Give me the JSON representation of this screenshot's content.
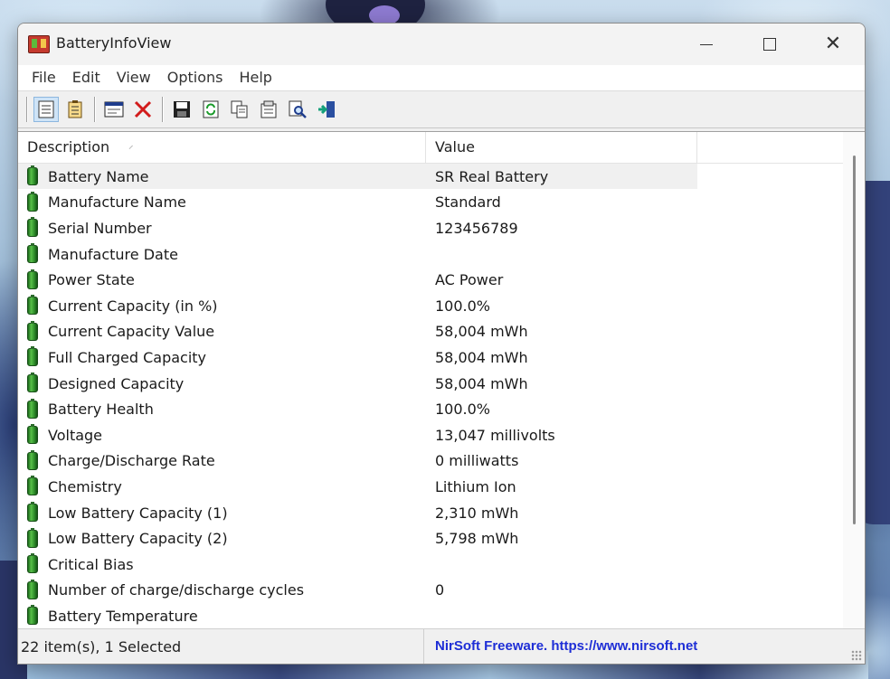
{
  "window": {
    "title": "BatteryInfoView",
    "minimize_label": "Minimize",
    "maximize_label": "Maximize",
    "close_label": "Close"
  },
  "menu": [
    "File",
    "Edit",
    "View",
    "Options",
    "Help"
  ],
  "toolbar": {
    "buttons": [
      {
        "icon": "battery-info-mode-icon",
        "active": true
      },
      {
        "icon": "battery-log-mode-icon",
        "active": false
      },
      {
        "icon": "html-report-icon",
        "active": false
      },
      {
        "icon": "delete-icon",
        "active": false
      },
      {
        "icon": "save-icon",
        "active": false
      },
      {
        "icon": "refresh-icon",
        "active": false
      },
      {
        "icon": "copy-icon",
        "active": false
      },
      {
        "icon": "properties-icon",
        "active": false
      },
      {
        "icon": "find-icon",
        "active": false
      },
      {
        "icon": "exit-icon",
        "active": false
      }
    ]
  },
  "list": {
    "columns": {
      "description": "Description",
      "value": "Value"
    },
    "rows": [
      {
        "description": "Battery Name",
        "value": "SR Real Battery",
        "selected": true
      },
      {
        "description": "Manufacture Name",
        "value": "Standard"
      },
      {
        "description": "Serial Number",
        "value": "123456789"
      },
      {
        "description": "Manufacture Date",
        "value": ""
      },
      {
        "description": "Power State",
        "value": "AC Power"
      },
      {
        "description": "Current Capacity (in %)",
        "value": "100.0%"
      },
      {
        "description": "Current Capacity Value",
        "value": "58,004 mWh"
      },
      {
        "description": "Full Charged Capacity",
        "value": "58,004 mWh"
      },
      {
        "description": "Designed Capacity",
        "value": "58,004 mWh"
      },
      {
        "description": "Battery Health",
        "value": "100.0%"
      },
      {
        "description": "Voltage",
        "value": "13,047 millivolts"
      },
      {
        "description": "Charge/Discharge Rate",
        "value": "0 milliwatts"
      },
      {
        "description": "Chemistry",
        "value": "Lithium Ion"
      },
      {
        "description": "Low Battery Capacity (1)",
        "value": "2,310 mWh"
      },
      {
        "description": "Low Battery Capacity (2)",
        "value": "5,798 mWh"
      },
      {
        "description": "Critical Bias",
        "value": ""
      },
      {
        "description": "Number of charge/discharge cycles",
        "value": "0"
      },
      {
        "description": "Battery Temperature",
        "value": ""
      }
    ]
  },
  "status": {
    "items": "22 item(s), 1 Selected",
    "link": "NirSoft Freeware. https://www.nirsoft.net"
  },
  "colors": {
    "selected_row": "#f0f0f0",
    "link": "#1e2ed6",
    "battery_icon": "#3a9c34"
  }
}
